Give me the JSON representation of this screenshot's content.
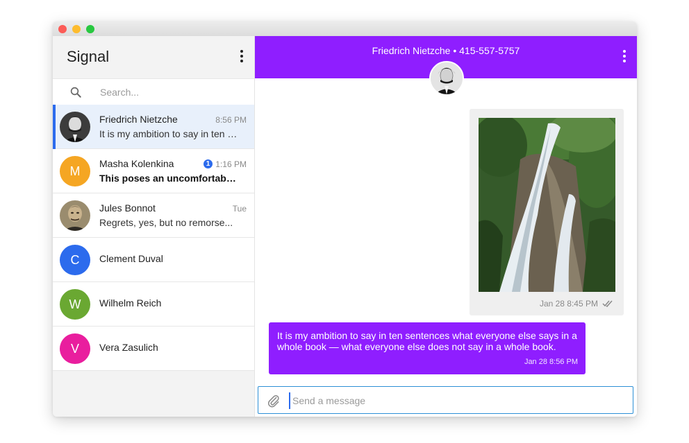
{
  "app": {
    "title": "Signal"
  },
  "search": {
    "placeholder": "Search..."
  },
  "conversations": [
    {
      "name": "Friedrich Nietzche",
      "time": "8:56 PM",
      "preview": "It is my ambition to say in ten sentences what everyone else says in a whole book",
      "avatar": "photo",
      "active": true
    },
    {
      "name": "Masha Kolenkina",
      "time": "1:16 PM",
      "unread": "1",
      "preview": "This poses an uncomfortable question",
      "initial": "M",
      "color": "#f5a623",
      "bold": true
    },
    {
      "name": "Jules Bonnot",
      "time": "Tue",
      "preview": "Regrets, yes, but no remorse...",
      "avatar": "photo"
    },
    {
      "name": "Clement Duval",
      "initial": "C",
      "color": "#2c6bed"
    },
    {
      "name": "Wilhelm Reich",
      "initial": "W",
      "color": "#6aa832"
    },
    {
      "name": "Vera Zasulich",
      "initial": "V",
      "color": "#e91e9e"
    }
  ],
  "header": {
    "title": "Friedrich Nietzche • 415-557-5757",
    "color": "#8f1eff"
  },
  "messages": [
    {
      "type": "image",
      "image": "waterfall",
      "timestamp": "Jan 28 8:45 PM",
      "status": "read"
    },
    {
      "type": "text",
      "text": "It is my ambition to say in ten sentences what everyone else says in a whole book — what everyone else does not say in a whole book.",
      "timestamp": "Jan 28 8:56 PM"
    }
  ],
  "composer": {
    "placeholder": "Send a message"
  }
}
